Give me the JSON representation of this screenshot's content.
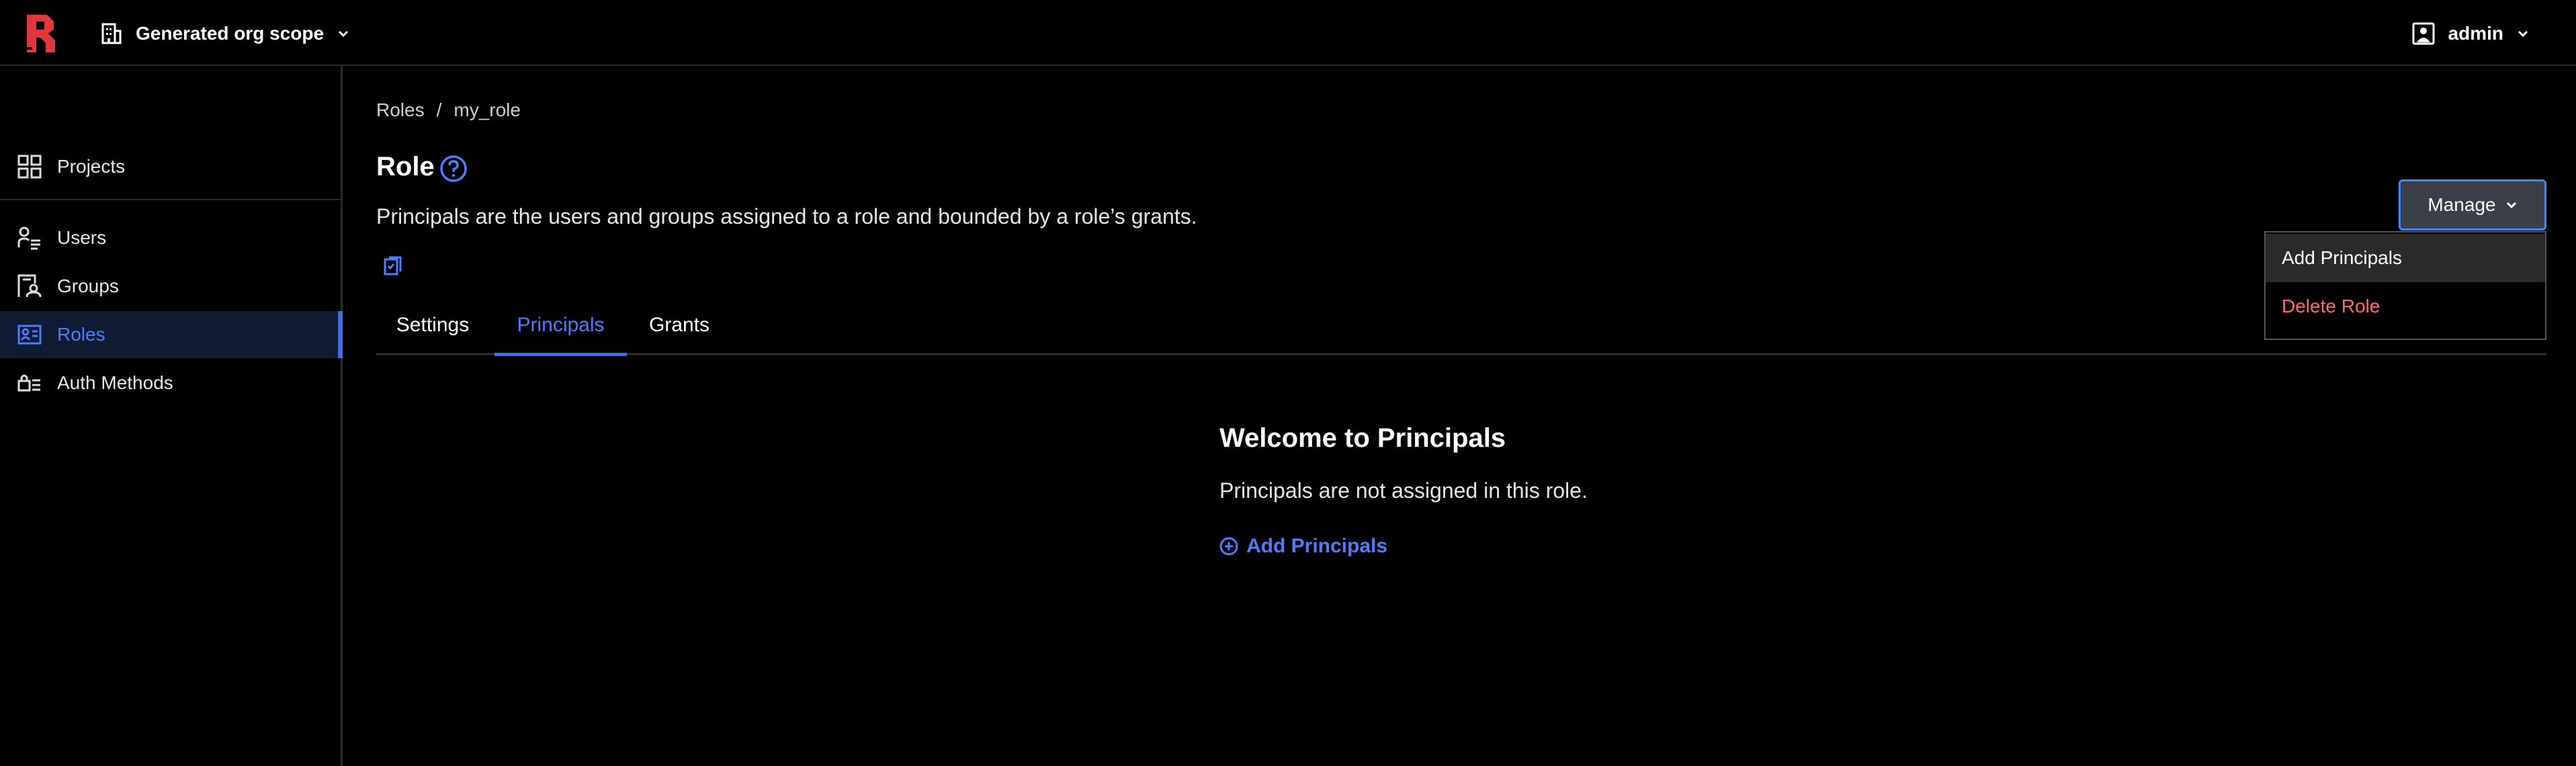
{
  "header": {
    "org_scope_label": "Generated org scope",
    "user_label": "admin"
  },
  "sidebar": {
    "items": [
      {
        "label": "Projects",
        "icon": "grid-icon"
      },
      {
        "label": "Users",
        "icon": "users-icon"
      },
      {
        "label": "Groups",
        "icon": "groups-icon"
      },
      {
        "label": "Roles",
        "icon": "roles-icon",
        "active": true
      },
      {
        "label": "Auth Methods",
        "icon": "auth-methods-icon"
      }
    ]
  },
  "breadcrumb": {
    "parent": "Roles",
    "separator": "/",
    "current": "my_role"
  },
  "page": {
    "title": "Role",
    "description": "Principals are the users and groups assigned to a role and bounded by a role’s grants."
  },
  "tabs": [
    {
      "label": "Settings"
    },
    {
      "label": "Principals",
      "active": true
    },
    {
      "label": "Grants"
    }
  ],
  "empty_state": {
    "title": "Welcome to Principals",
    "message": "Principals are not assigned in this role.",
    "action_label": "Add Principals"
  },
  "manage": {
    "button_label": "Manage",
    "menu": [
      {
        "label": "Add Principals"
      },
      {
        "label": "Delete Role"
      }
    ]
  },
  "colors": {
    "accent": "#3b6cf6",
    "link": "#4d7cff",
    "danger": "#ff6b6b",
    "background": "#000000"
  }
}
